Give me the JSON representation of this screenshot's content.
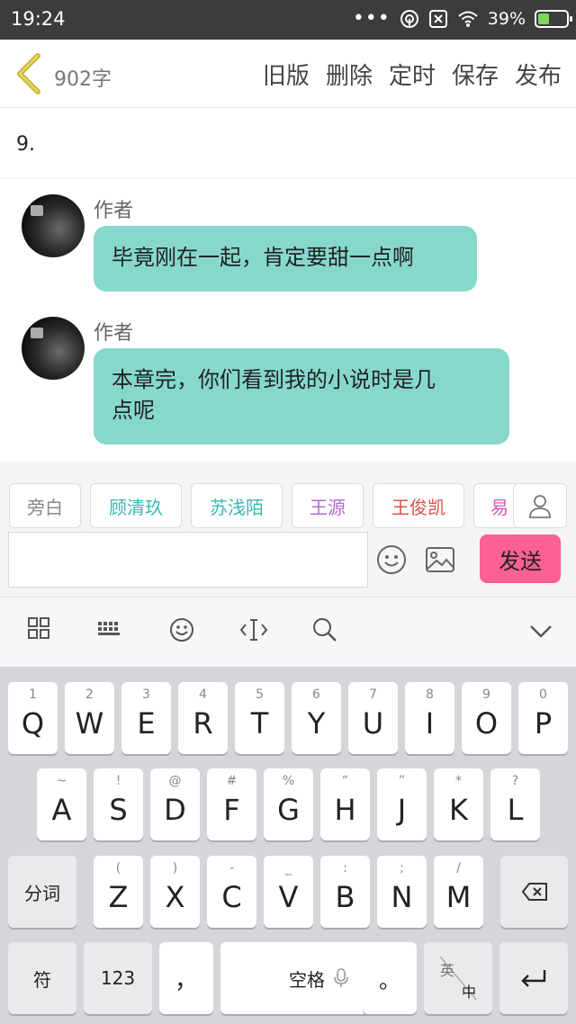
{
  "status": {
    "time": "19:24",
    "battery": "39%",
    "battery_level": 0.39
  },
  "header": {
    "word_count": "902字",
    "buttons": [
      "旧版",
      "删除",
      "定时",
      "保存",
      "发布"
    ]
  },
  "content": {
    "line_number": "9."
  },
  "messages": [
    {
      "author": "作者",
      "text_lines": [
        "毕竟刚在一起，肯定要甜一点啊"
      ]
    },
    {
      "author": "作者",
      "text_lines": [
        "本章完，你们看到我的小说时是几",
        "点呢"
      ]
    }
  ],
  "roles": [
    {
      "label": "旁白",
      "color": "#888888"
    },
    {
      "label": "顾清玖",
      "color": "#38b9b3"
    },
    {
      "label": "苏浅陌",
      "color": "#38b9b3"
    },
    {
      "label": "王源",
      "color": "#b26ad1"
    },
    {
      "label": "王俊凯",
      "color": "#d8544a"
    },
    {
      "label": "易",
      "color": "#d45ab6"
    }
  ],
  "composer": {
    "send_label": "发送",
    "placeholder": ""
  },
  "keyboard": {
    "row1": [
      {
        "hint": "1",
        "key": "Q"
      },
      {
        "hint": "2",
        "key": "W"
      },
      {
        "hint": "3",
        "key": "E"
      },
      {
        "hint": "4",
        "key": "R"
      },
      {
        "hint": "5",
        "key": "T"
      },
      {
        "hint": "6",
        "key": "Y"
      },
      {
        "hint": "7",
        "key": "U"
      },
      {
        "hint": "8",
        "key": "I"
      },
      {
        "hint": "9",
        "key": "O"
      },
      {
        "hint": "0",
        "key": "P"
      }
    ],
    "row2": [
      {
        "hint": "~",
        "key": "A"
      },
      {
        "hint": "!",
        "key": "S"
      },
      {
        "hint": "@",
        "key": "D"
      },
      {
        "hint": "#",
        "key": "F"
      },
      {
        "hint": "%",
        "key": "G"
      },
      {
        "hint": "“",
        "key": "H"
      },
      {
        "hint": "”",
        "key": "J"
      },
      {
        "hint": "*",
        "key": "K"
      },
      {
        "hint": "?",
        "key": "L"
      }
    ],
    "row3": [
      {
        "hint": "(",
        "key": "Z"
      },
      {
        "hint": ")",
        "key": "X"
      },
      {
        "hint": "-",
        "key": "C"
      },
      {
        "hint": "_",
        "key": "V"
      },
      {
        "hint": ":",
        "key": "B"
      },
      {
        "hint": ";",
        "key": "N"
      },
      {
        "hint": "/",
        "key": "M"
      }
    ],
    "fenci": "分词",
    "symbol": "符",
    "num": "123",
    "comma": "，",
    "space": "空格",
    "period": "。",
    "lang_top": "英",
    "lang_bottom": "中"
  }
}
